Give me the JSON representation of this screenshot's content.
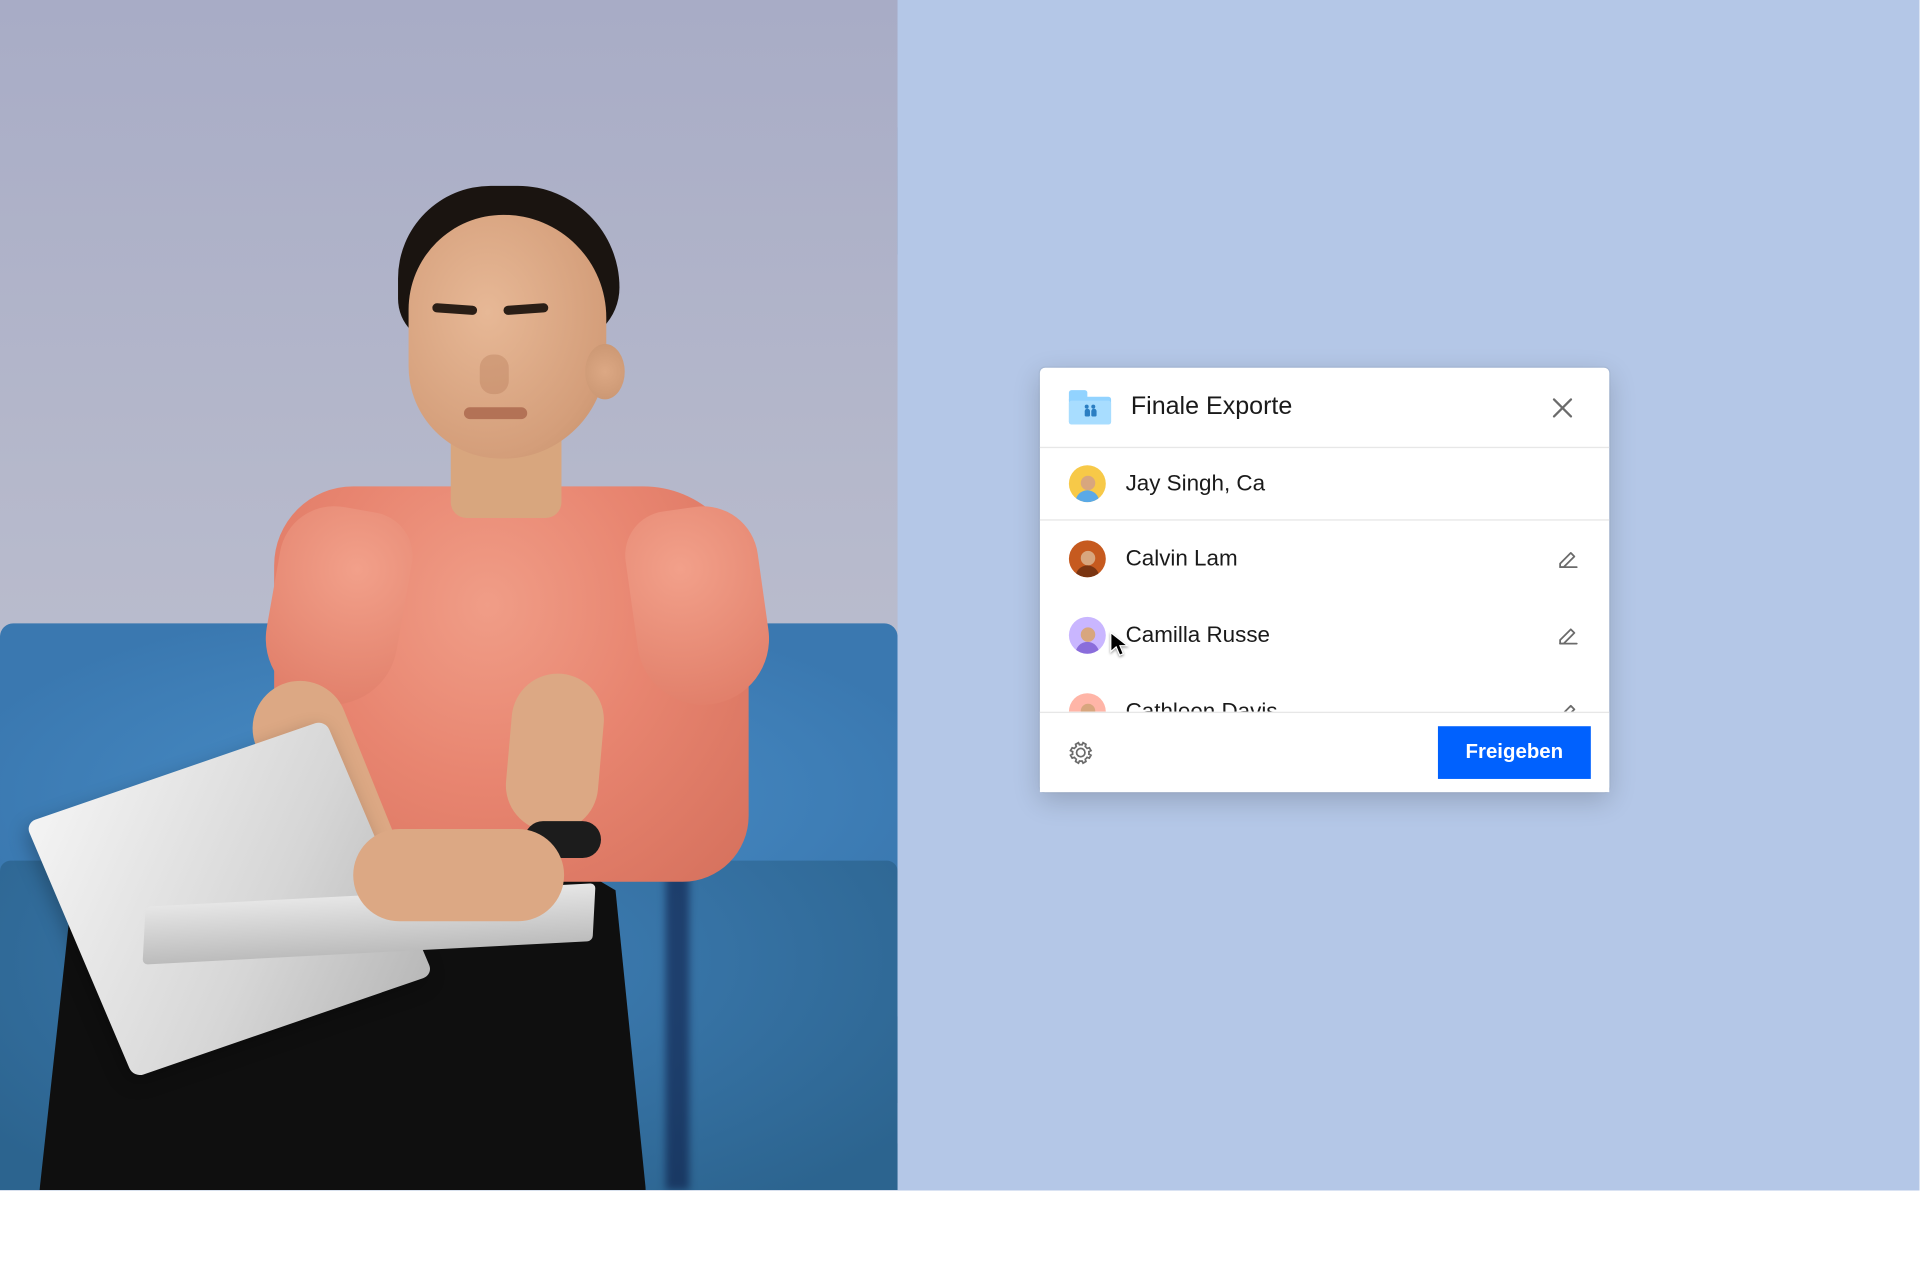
{
  "dialog": {
    "title": "Finale Exporte",
    "input_value": "Jay Singh, Ca",
    "submit_label": "Freigeben"
  },
  "input_chip": {
    "name": "Jay Singh",
    "avatar_bg": "#f7c948",
    "avatar_shirt": "#5aa9e6"
  },
  "suggestions": [
    {
      "name": "Calvin Lam",
      "avatar_bg": "#c65a1f",
      "avatar_shirt": "#7a3512"
    },
    {
      "name": "Camilla Russe",
      "avatar_bg": "#c9b6ff",
      "avatar_shirt": "#8a6ddb"
    },
    {
      "name": "Cathleen Davis",
      "avatar_bg": "#ffb5a7",
      "avatar_shirt": "#d97a66"
    }
  ],
  "icons": {
    "folder": "shared-folder-icon",
    "close": "close-icon",
    "edit": "pencil-icon",
    "settings": "gear-icon"
  },
  "colors": {
    "primary": "#0061fe",
    "panel_bg": "#b4c7e7",
    "folder": "#a8ddff"
  }
}
